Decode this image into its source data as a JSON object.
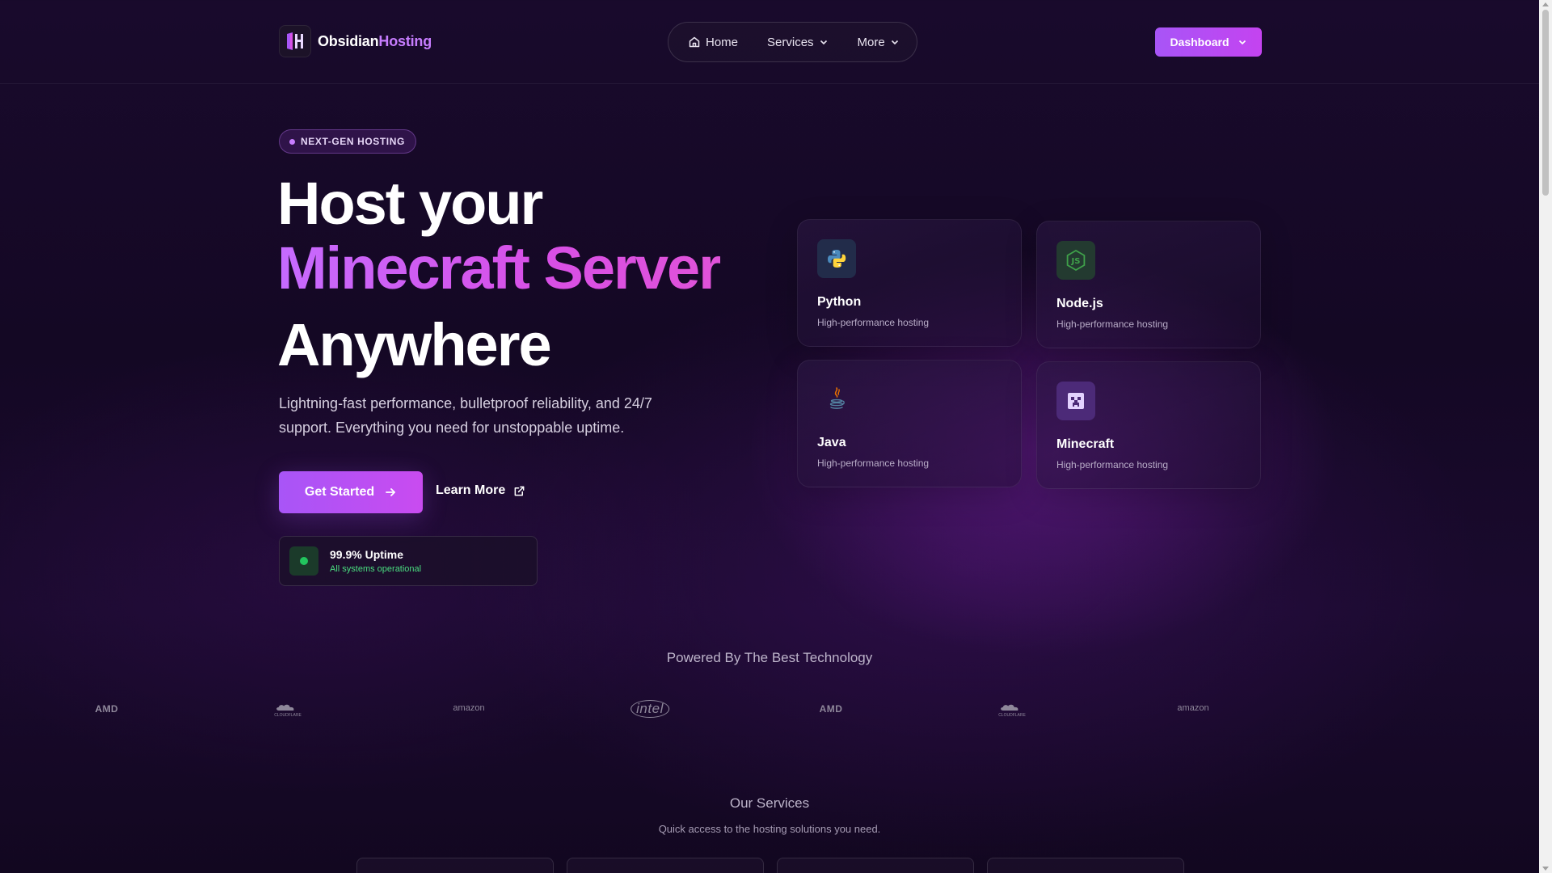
{
  "header": {
    "logo_primary": "Obsidian",
    "logo_accent": "Hosting",
    "nav": [
      {
        "label": "Home",
        "icon": "home-icon"
      },
      {
        "label": "Services",
        "icon": "chevron-down-icon"
      },
      {
        "label": "More",
        "icon": "chevron-down-icon"
      }
    ],
    "dashboard_label": "Dashboard"
  },
  "hero": {
    "badge": "NEXT-GEN HOSTING",
    "line1": "Host your",
    "line2": "Minecraft Server",
    "line3": "Anywhere",
    "subtitle": "Lightning-fast performance, bulletproof reliability, and 24/7 support. Everything you need for unstoppable uptime.",
    "cta_primary": "Get Started",
    "cta_secondary": "Learn More",
    "status_title": "99.9% Uptime",
    "status_sub": "All systems operational"
  },
  "cards": [
    {
      "name": "Python",
      "desc": "High-performance hosting",
      "icon": "python-icon"
    },
    {
      "name": "Node.js",
      "desc": "High-performance hosting",
      "icon": "nodejs-icon"
    },
    {
      "name": "Java",
      "desc": "High-performance hosting",
      "icon": "java-icon"
    },
    {
      "name": "Minecraft",
      "desc": "High-performance hosting",
      "icon": "minecraft-icon"
    }
  ],
  "powered": {
    "title": "Powered By The Best Technology",
    "brands": [
      "AMD",
      "CLOUDFLARE",
      "amazon",
      "intel",
      "AMD",
      "CLOUDFLARE",
      "amazon"
    ]
  },
  "services": {
    "title": "Our Services",
    "subtitle": "Quick access to the hosting solutions you need."
  },
  "colors": {
    "accent": "#a855f7",
    "accent_pink": "#d84fe6",
    "status_green": "#22c55e",
    "background": "#140824"
  }
}
